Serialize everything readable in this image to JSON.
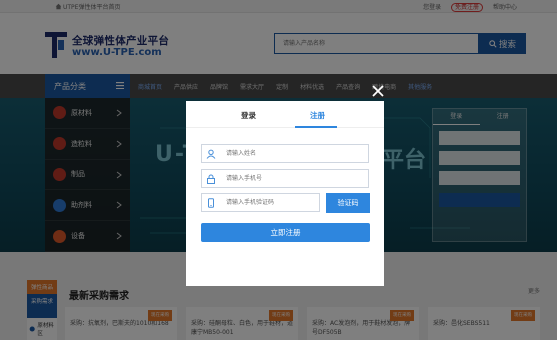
{
  "topbar": {
    "welcome": "UTPE弹性体平台首页",
    "login": "您登录",
    "register": "免费注册",
    "help": "帮助中心"
  },
  "header": {
    "logo_cn": "全球弹性体产业平台",
    "logo_en": "www.U-TPE.com",
    "search_placeholder": "请输入产品名称",
    "search_button": "搜索"
  },
  "nav": {
    "category_title": "产品分类",
    "items": [
      "商城首页",
      "产品供应",
      "品牌馆",
      "需求大厅",
      "定制",
      "材料优选",
      "产品查询",
      "跨境电商",
      "其他服务"
    ]
  },
  "sidebar": {
    "items": [
      {
        "label": "原材料",
        "color": "#c0392b"
      },
      {
        "label": "造粒料",
        "color": "#c0392b"
      },
      {
        "label": "制品",
        "color": "#c0392b"
      },
      {
        "label": "助剂料",
        "color": "#2e7bd6"
      },
      {
        "label": "设备",
        "color": "#e05a2a"
      }
    ]
  },
  "banner": {
    "text_left": "U-T",
    "text_right": "平台"
  },
  "login_panel": {
    "tab_login": "登录",
    "tab_register": "注册"
  },
  "lower": {
    "side_tab_1": "弹性商品",
    "side_tab_2": "采购需求",
    "side_tab_3": "原材料区",
    "section_title": "最新采购需求",
    "more": "更多",
    "cards": [
      {
        "tag": "现在采购",
        "text": "采购：抗氧剂，巴斯夫的1010和168"
      },
      {
        "tag": "现在采购",
        "text": "采购：硅酮母粒、白色，用于鞋材，道康宁MB50-001"
      },
      {
        "tag": "现在采购",
        "text": "采购：AC发泡剂，用于鞋材发泡，牌号DF505B"
      },
      {
        "tag": "现在采购",
        "text": "采购：邑化SEBS511"
      }
    ]
  },
  "modal": {
    "tab_login": "登录",
    "tab_register": "注册",
    "name_placeholder": "请输入姓名",
    "phone_placeholder": "请输入手机号",
    "code_placeholder": "请输入手机验证码",
    "code_button": "验证码",
    "submit_button": "立即注册"
  },
  "colors": {
    "primary": "#1a58a3",
    "accent": "#2e86de",
    "orange": "#e5782a"
  }
}
